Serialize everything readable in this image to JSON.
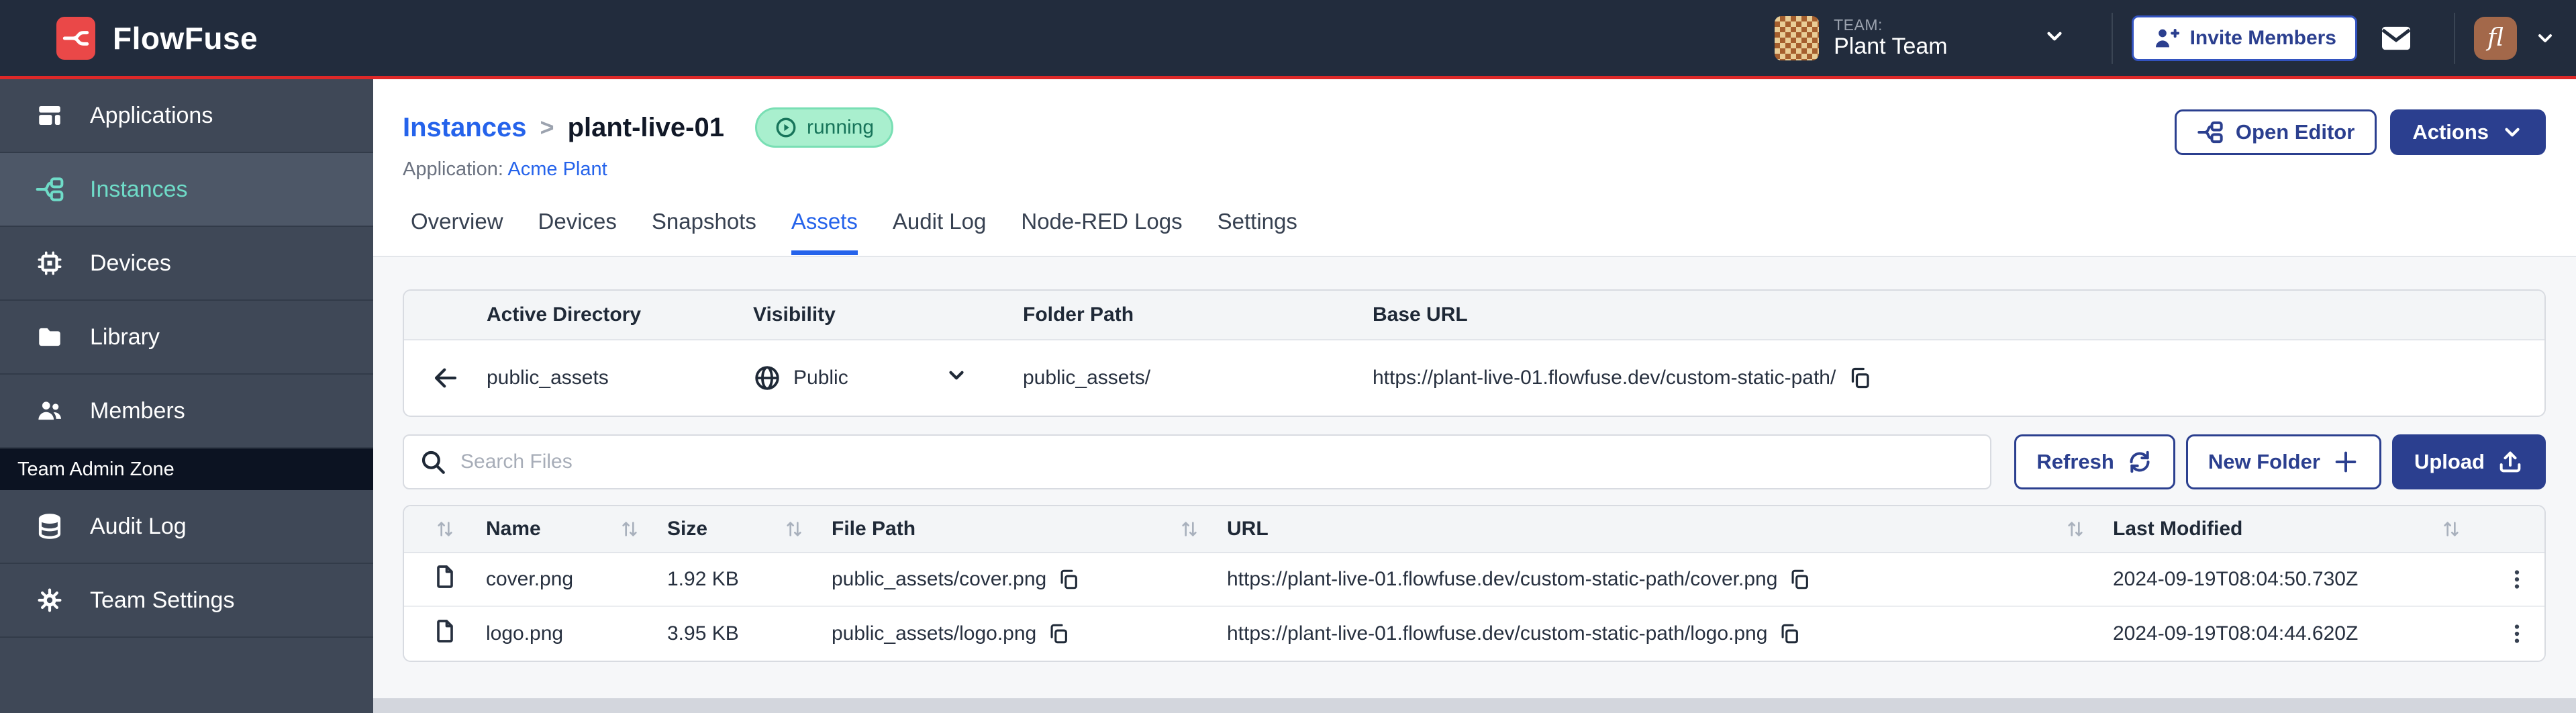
{
  "header": {
    "logo_text": "FlowFuse",
    "team_label": "TEAM:",
    "team_name": "Plant Team",
    "invite_button": "Invite Members",
    "avatar_initials": "fl"
  },
  "sidebar": {
    "items": [
      {
        "label": "Applications"
      },
      {
        "label": "Instances"
      },
      {
        "label": "Devices"
      },
      {
        "label": "Library"
      },
      {
        "label": "Members"
      }
    ],
    "admin_zone_label": "Team Admin Zone",
    "admin_items": [
      {
        "label": "Audit Log"
      },
      {
        "label": "Team Settings"
      }
    ]
  },
  "main": {
    "breadcrumb": {
      "parent": "Instances",
      "separator": ">",
      "current": "plant-live-01"
    },
    "status_badge": "running",
    "application_label": "Application:",
    "application_name": "Acme Plant",
    "open_editor_button": "Open Editor",
    "actions_button": "Actions",
    "tabs": [
      "Overview",
      "Devices",
      "Snapshots",
      "Assets",
      "Audit Log",
      "Node-RED Logs",
      "Settings"
    ],
    "active_tab": "Assets",
    "directory_card": {
      "headers": [
        "Active Directory",
        "Visibility",
        "Folder Path",
        "Base URL"
      ],
      "row": {
        "name": "public_assets",
        "visibility": "Public",
        "folder_path": "public_assets/",
        "base_url": "https://plant-live-01.flowfuse.dev/custom-static-path/"
      }
    },
    "toolbar": {
      "search_placeholder": "Search Files",
      "refresh_button": "Refresh",
      "new_folder_button": "New Folder",
      "upload_button": "Upload"
    },
    "files_table": {
      "columns": [
        "Name",
        "Size",
        "File Path",
        "URL",
        "Last Modified"
      ],
      "rows": [
        {
          "name": "cover.png",
          "size": "1.92 KB",
          "file_path": "public_assets/cover.png",
          "url": "https://plant-live-01.flowfuse.dev/custom-static-path/cover.png",
          "last_modified": "2024-09-19T08:04:50.730Z"
        },
        {
          "name": "logo.png",
          "size": "3.95 KB",
          "file_path": "public_assets/logo.png",
          "url": "https://plant-live-01.flowfuse.dev/custom-static-path/logo.png",
          "last_modified": "2024-09-19T08:04:44.620Z"
        }
      ]
    }
  },
  "colors": {
    "brand_red": "#EA4848",
    "header_bg": "#222C3D",
    "sidebar_bg": "#3F4857",
    "accent_navy": "#2B3F8F",
    "link_blue": "#2563EB",
    "active_teal": "#6FDCC8",
    "badge_green_bg": "#A9EFCE",
    "badge_green_text": "#17745A"
  }
}
